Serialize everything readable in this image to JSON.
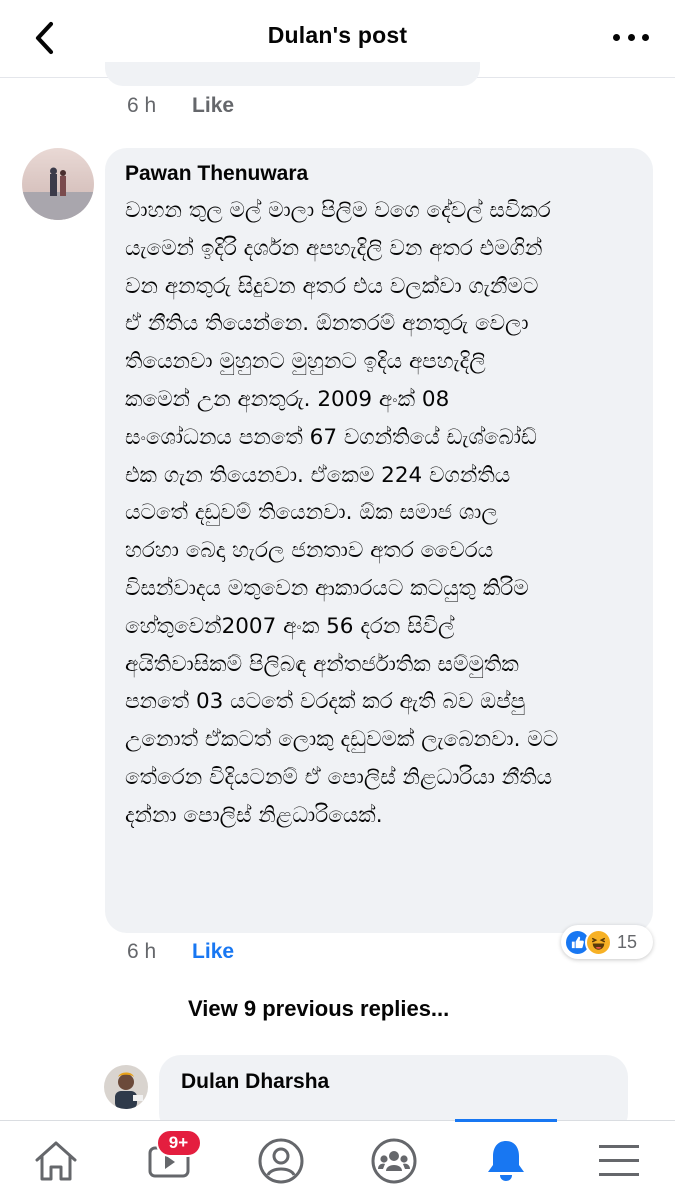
{
  "header": {
    "title": "Dulan's post"
  },
  "previous_comment": {
    "time": "6 h",
    "like_label": "Like"
  },
  "comment": {
    "author": "Pawan Thenuwara",
    "lines": [
      "වාහන තුල මල් මාලා පිලිම වගෙ දේවල් සවිකර",
      "යැමෙන් ඉදිරි දර්ශන අපහැදිලි වන අතර එමගින්",
      "වන අනතුරු සිදුවන අතර එය වලක්වා ගැනීමට",
      "ඒ නීතිය තියෙන්නෙ. ඕනතරම් අනතුරු වෙලා",
      "තියෙනවා මුහුනට මුහුනට ඉදිය අපහැදිලි",
      "කමෙන් උන අනතුරු. 2009 අංක් 08",
      "සංශෝධනය පනතේ 67 වගන්තියේ ඩැශ්බෝඩ්",
      "එක ගැන තියෙනවා. ඒකෙම 224 වගන්තිය",
      "යටතේ දඩුවම් තියෙනවා. ඕක සමාජ ශාල",
      "හරහා බෙදා හැරල ජනතාව අතර වෛරය",
      "විසන්වාදය මතුවෙන ආකාරයට කටයුතු කිරිම",
      "හේතුවෙන්2007 අංක 56 දරන සිවිල්",
      "අයිතිවාසිකම් පිලිබඳ අන්තර්ජාතික සම්මුතික",
      "පනතේ 03 යටතේ වරදක් කර ඇති බව ඔප්පු",
      "උනොත් ඒකටත් ලොකු දඩුවමක් ලැබෙනවා. මට",
      "තේරෙන විදියටනම් ඒ පොලිස් නිළධාරියා නීතිය",
      "දන්නා පොලිස් නිළධාරියෙක්."
    ],
    "time": "6 h",
    "like_label": "Like",
    "reaction_count": "15",
    "reaction_icons": [
      "like-icon",
      "haha-icon"
    ],
    "like_color": "#1877f2"
  },
  "view_previous": "View 9 previous replies...",
  "reply": {
    "author": "Dulan Dharsha"
  },
  "bottom_nav": {
    "items": [
      {
        "icon": "home-icon"
      },
      {
        "icon": "watch-icon",
        "badge": "9+"
      },
      {
        "icon": "profile-icon"
      },
      {
        "icon": "groups-icon"
      },
      {
        "icon": "notifications-icon"
      },
      {
        "icon": "menu-icon"
      }
    ],
    "active_color": "#1877f2"
  }
}
